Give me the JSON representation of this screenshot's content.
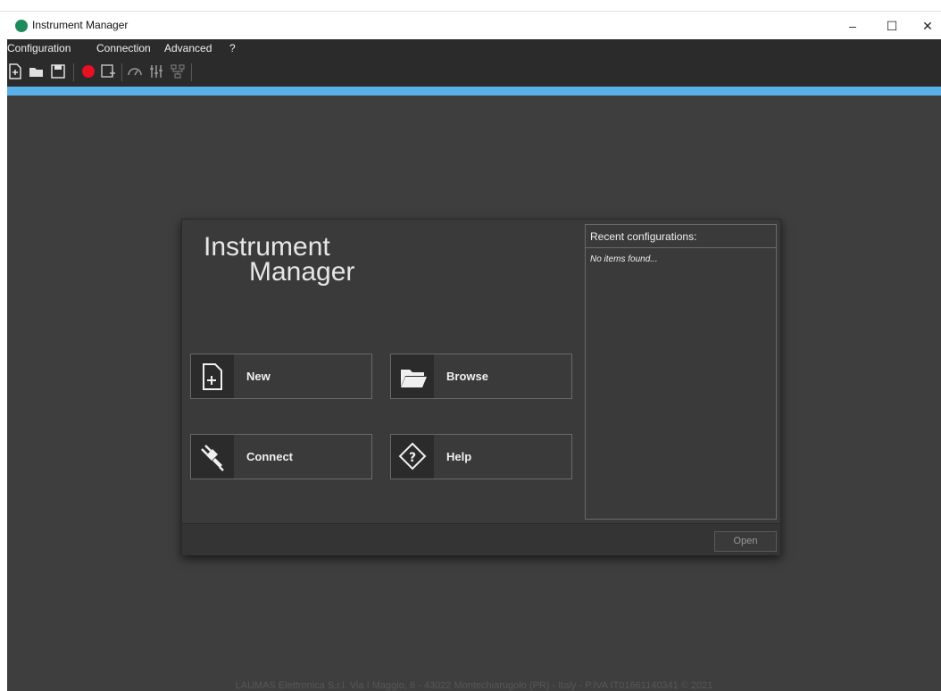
{
  "window": {
    "title": "Instrument Manager",
    "minimize": "–",
    "maximize": "☐",
    "close": "✕"
  },
  "menu": {
    "items": [
      "Configuration",
      "Connection",
      "Advanced",
      "?"
    ]
  },
  "toolbar": {
    "icons": [
      "new-file-icon",
      "open-folder-icon",
      "save-icon",
      "record-icon",
      "save-config-icon",
      "gauge-icon",
      "sliders-icon",
      "network-icon"
    ],
    "record_color": "#e81123"
  },
  "accent_color": "#5ab0e8",
  "logo": {
    "line1": "Instrument",
    "line2": "Manager"
  },
  "actions": {
    "new": "New",
    "browse": "Browse",
    "connect": "Connect",
    "help": "Help"
  },
  "recent": {
    "title": "Recent configurations:",
    "empty": "No items found..."
  },
  "open_label": "Open",
  "footer": "LAUMAS Elettronica S.r.l. Via I Maggio, 6 - 43022 Montechiarugolo (PR) - Italy - P.IVA IT01661140341      © 2021"
}
